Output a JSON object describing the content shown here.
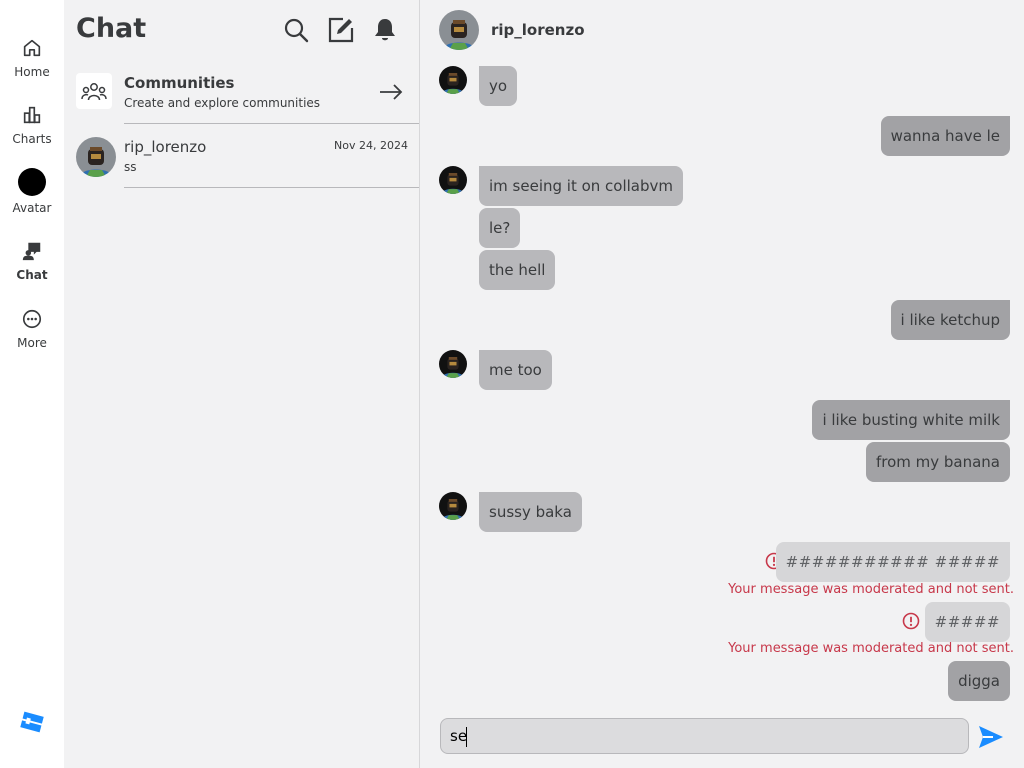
{
  "nav": {
    "items": [
      {
        "label": "Home",
        "icon": "home-icon"
      },
      {
        "label": "Charts",
        "icon": "charts-icon"
      },
      {
        "label": "Avatar",
        "icon": "avatar-icon"
      },
      {
        "label": "Chat",
        "icon": "chat-icon"
      },
      {
        "label": "More",
        "icon": "more-icon"
      }
    ],
    "logo_icon": "roblox-logo-icon"
  },
  "chat_list": {
    "title": "Chat",
    "header_icons": [
      "search-icon",
      "compose-icon",
      "bell-icon"
    ],
    "communities": {
      "title": "Communities",
      "subtitle": "Create and explore communities"
    },
    "conversations": [
      {
        "name": "rip_lorenzo",
        "date": "Nov 24, 2024",
        "preview": "ss"
      }
    ]
  },
  "conversation": {
    "partner": "rip_lorenzo",
    "messages": [
      {
        "side": "in",
        "text": "yo"
      },
      {
        "side": "out",
        "text": "wanna have le"
      },
      {
        "side": "in",
        "text": "im seeing it on collabvm"
      },
      {
        "side": "in",
        "text": "le?"
      },
      {
        "side": "in",
        "text": "the hell"
      },
      {
        "side": "out",
        "text": "i like ketchup"
      },
      {
        "side": "in",
        "text": "me too"
      },
      {
        "side": "out",
        "text": "i like busting white milk"
      },
      {
        "side": "out",
        "text": "from my banana"
      },
      {
        "side": "in",
        "text": "sussy baka"
      },
      {
        "side": "out",
        "text": "########### #####",
        "moderated": true
      },
      {
        "side": "out",
        "text": "#####",
        "moderated": true
      },
      {
        "side": "out",
        "text": "digga"
      }
    ],
    "moderation_note": "Your message was moderated and not sent.",
    "composer": {
      "value": "se"
    }
  },
  "colors": {
    "accent": "#1a8cff",
    "error": "#c7384a",
    "incoming_bubble": "#b8b8bb",
    "outgoing_bubble": "#a2a2a5",
    "moderated_bubble": "#d6d6d8"
  }
}
